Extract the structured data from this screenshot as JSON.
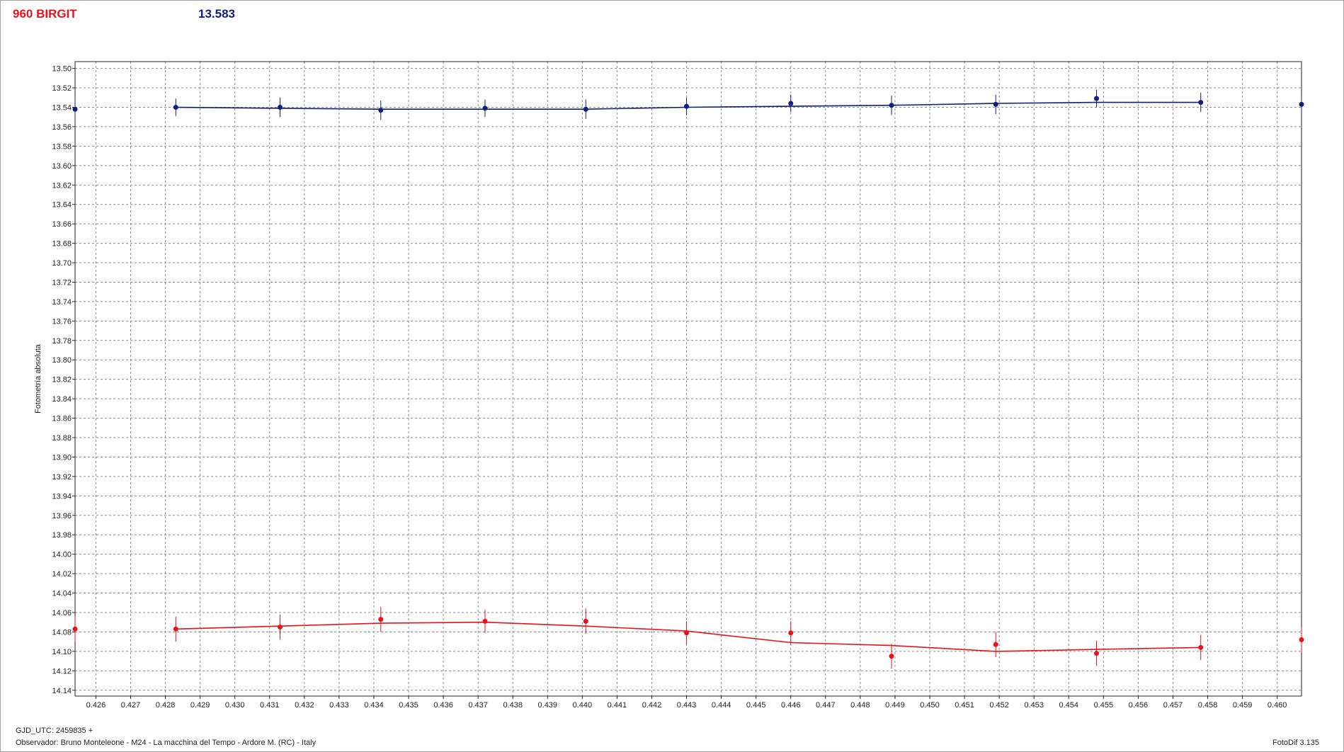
{
  "header": {
    "object_name": "960 BIRGIT",
    "value": "13.583"
  },
  "footer": {
    "gjd": "GJD_UTC: 2459835 +",
    "observer": "Observador: Bruno Monteleone - M24 - La macchina del Tempo - Ardore M. (RC) - Italy",
    "software": "FotoDif 3.135"
  },
  "colors": {
    "series_1": "#101d7a",
    "series_2": "#e8121a",
    "grid": "#8a8a8a"
  },
  "chart_data": {
    "type": "line",
    "title": "",
    "xlabel": "",
    "ylabel": "Fotometría absoluta",
    "xlim": [
      0.4254,
      0.4607
    ],
    "ylim": [
      13.493,
      14.146
    ],
    "y_inverted": true,
    "grid": true,
    "x_ticks": [
      "0.426",
      "0.427",
      "0.428",
      "0.429",
      "0.430",
      "0.431",
      "0.432",
      "0.433",
      "0.434",
      "0.435",
      "0.436",
      "0.437",
      "0.438",
      "0.439",
      "0.440",
      "0.441",
      "0.442",
      "0.443",
      "0.444",
      "0.445",
      "0.446",
      "0.447",
      "0.448",
      "0.449",
      "0.450",
      "0.451",
      "0.452",
      "0.453",
      "0.454",
      "0.455",
      "0.456",
      "0.457",
      "0.458",
      "0.459",
      "0.460"
    ],
    "y_ticks": [
      "13.50",
      "13.52",
      "13.54",
      "13.56",
      "13.58",
      "13.60",
      "13.62",
      "13.64",
      "13.66",
      "13.68",
      "13.70",
      "13.72",
      "13.74",
      "13.76",
      "13.78",
      "13.80",
      "13.82",
      "13.84",
      "13.86",
      "13.88",
      "13.90",
      "13.92",
      "13.94",
      "13.96",
      "13.98",
      "14.00",
      "14.02",
      "14.04",
      "14.06",
      "14.08",
      "14.10",
      "14.12",
      "14.14"
    ],
    "series": [
      {
        "color": "#101d7a",
        "points": [
          {
            "x": 0.4254,
            "y": 13.542,
            "err": 0.01
          },
          {
            "x": 0.4283,
            "y": 13.54,
            "err": 0.009
          },
          {
            "x": 0.4313,
            "y": 13.54,
            "err": 0.01
          },
          {
            "x": 0.4342,
            "y": 13.543,
            "err": 0.01
          },
          {
            "x": 0.4372,
            "y": 13.541,
            "err": 0.009
          },
          {
            "x": 0.4401,
            "y": 13.542,
            "err": 0.01
          },
          {
            "x": 0.443,
            "y": 13.539,
            "err": 0.009
          },
          {
            "x": 0.446,
            "y": 13.536,
            "err": 0.009
          },
          {
            "x": 0.4489,
            "y": 13.538,
            "err": 0.01
          },
          {
            "x": 0.4519,
            "y": 13.537,
            "err": 0.01
          },
          {
            "x": 0.4548,
            "y": 13.531,
            "err": 0.009
          },
          {
            "x": 0.4578,
            "y": 13.535,
            "err": 0.01
          },
          {
            "x": 0.4607,
            "y": 13.537,
            "err": 0.01
          }
        ],
        "fit": [
          {
            "x": 0.4283,
            "y": 13.54
          },
          {
            "x": 0.4313,
            "y": 13.541
          },
          {
            "x": 0.4342,
            "y": 13.542
          },
          {
            "x": 0.4372,
            "y": 13.542
          },
          {
            "x": 0.4401,
            "y": 13.542
          },
          {
            "x": 0.443,
            "y": 13.54
          },
          {
            "x": 0.446,
            "y": 13.539
          },
          {
            "x": 0.4489,
            "y": 13.538
          },
          {
            "x": 0.4519,
            "y": 13.536
          },
          {
            "x": 0.4548,
            "y": 13.535
          },
          {
            "x": 0.4578,
            "y": 13.535
          }
        ]
      },
      {
        "color": "#e8121a",
        "points": [
          {
            "x": 0.4254,
            "y": 14.077,
            "err": 0.013
          },
          {
            "x": 0.4283,
            "y": 14.077,
            "err": 0.013
          },
          {
            "x": 0.4313,
            "y": 14.075,
            "err": 0.013
          },
          {
            "x": 0.4342,
            "y": 14.067,
            "err": 0.013
          },
          {
            "x": 0.4372,
            "y": 14.069,
            "err": 0.012
          },
          {
            "x": 0.4401,
            "y": 14.069,
            "err": 0.013
          },
          {
            "x": 0.443,
            "y": 14.081,
            "err": 0.012
          },
          {
            "x": 0.446,
            "y": 14.081,
            "err": 0.012
          },
          {
            "x": 0.4489,
            "y": 14.105,
            "err": 0.013
          },
          {
            "x": 0.4519,
            "y": 14.093,
            "err": 0.013
          },
          {
            "x": 0.4548,
            "y": 14.102,
            "err": 0.013
          },
          {
            "x": 0.4578,
            "y": 14.096,
            "err": 0.013
          },
          {
            "x": 0.4607,
            "y": 14.088,
            "err": 0.013
          }
        ],
        "fit": [
          {
            "x": 0.4283,
            "y": 14.077
          },
          {
            "x": 0.4313,
            "y": 14.074
          },
          {
            "x": 0.4342,
            "y": 14.071
          },
          {
            "x": 0.4372,
            "y": 14.07
          },
          {
            "x": 0.4401,
            "y": 14.074
          },
          {
            "x": 0.443,
            "y": 14.079
          },
          {
            "x": 0.446,
            "y": 14.091
          },
          {
            "x": 0.4489,
            "y": 14.094
          },
          {
            "x": 0.4519,
            "y": 14.1
          },
          {
            "x": 0.4548,
            "y": 14.098
          },
          {
            "x": 0.4578,
            "y": 14.096
          }
        ]
      }
    ]
  }
}
